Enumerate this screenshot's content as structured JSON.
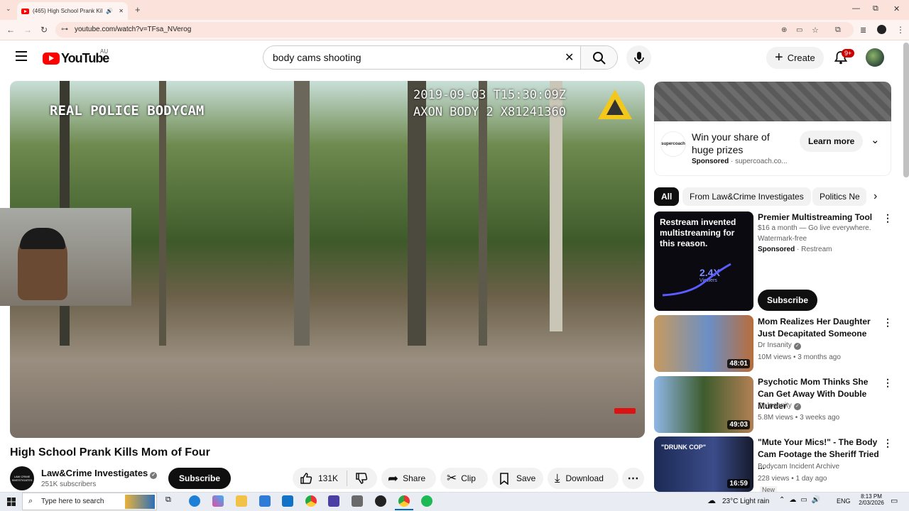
{
  "browser": {
    "tab_title": "(465) High School Prank Kil",
    "url": "youtube.com/watch?v=TFsa_NVerog",
    "window_min": "—",
    "window_max": "⧉",
    "window_close": "✕",
    "new_tab": "+"
  },
  "youtube": {
    "logo_text": "YouTube",
    "region": "AU",
    "search_value": "body cams shooting",
    "create_label": "Create",
    "notif_badge": "9+"
  },
  "video": {
    "overlay_left": "REAL POLICE BODYCAM",
    "overlay_timestamp": "2019-09-03 T15:30:09Z",
    "overlay_device": "AXON BODY 2 X81241360",
    "title": "High School Prank Kills Mom of Four"
  },
  "channel": {
    "name": "Law&Crime Investigates",
    "subscribers": "251K subscribers",
    "subscribe_label": "Subscribe",
    "avatar_text": "LAW CRIME INVESTIGATES"
  },
  "actions": {
    "likes": "131K",
    "share": "Share",
    "clip": "Clip",
    "save": "Save",
    "download": "Download"
  },
  "ad": {
    "title": "Win your share of huge prizes",
    "sponsored": "Sponsored",
    "domain": "supercoach.co...",
    "cta": "Learn more",
    "logo_text": "supercoach"
  },
  "chips": [
    "All",
    "From Law&Crime Investigates",
    "Politics Ne"
  ],
  "promo": {
    "title": "Premier Multistreaming Tool",
    "line1": "$16 a month — Go live everywhere.",
    "line2": "Watermark-free",
    "sponsored": "Sponsored",
    "advertiser": "Restream",
    "cta": "Subscribe",
    "thumb_text": "Restream invented multistreaming for this reason.",
    "thumb_stat": "2.4X",
    "thumb_stat_label": "Viewers"
  },
  "related": [
    {
      "title": "Mom Realizes Her Daughter Just Decapitated Someone",
      "channel": "Dr Insanity",
      "meta": "10M views • 3 months ago",
      "duration": "48:01"
    },
    {
      "title": "Psychotic Mom Thinks She Can Get Away With Double Murder",
      "channel": "Dr Insanity",
      "meta": "5.8M views • 3 weeks ago",
      "duration": "49:03"
    },
    {
      "title": "\"Mute Your Mics!\" - The Body Cam Footage the Sheriff Tried ...",
      "channel": "Bodycam Incident Archive",
      "meta": "228 views • 1 day ago",
      "duration": "16:59",
      "badge": "New",
      "thumb_text": "\"DRUNK COP\""
    }
  ],
  "taskbar": {
    "search_placeholder": "Type here to search",
    "weather": "23°C  Light rain",
    "lang": "ENG",
    "time": "8:13 PM",
    "date": "2/03/2026"
  },
  "colors": {
    "yt_red": "#ff0000",
    "chrome_tab_bg": "#fbe3dc"
  }
}
